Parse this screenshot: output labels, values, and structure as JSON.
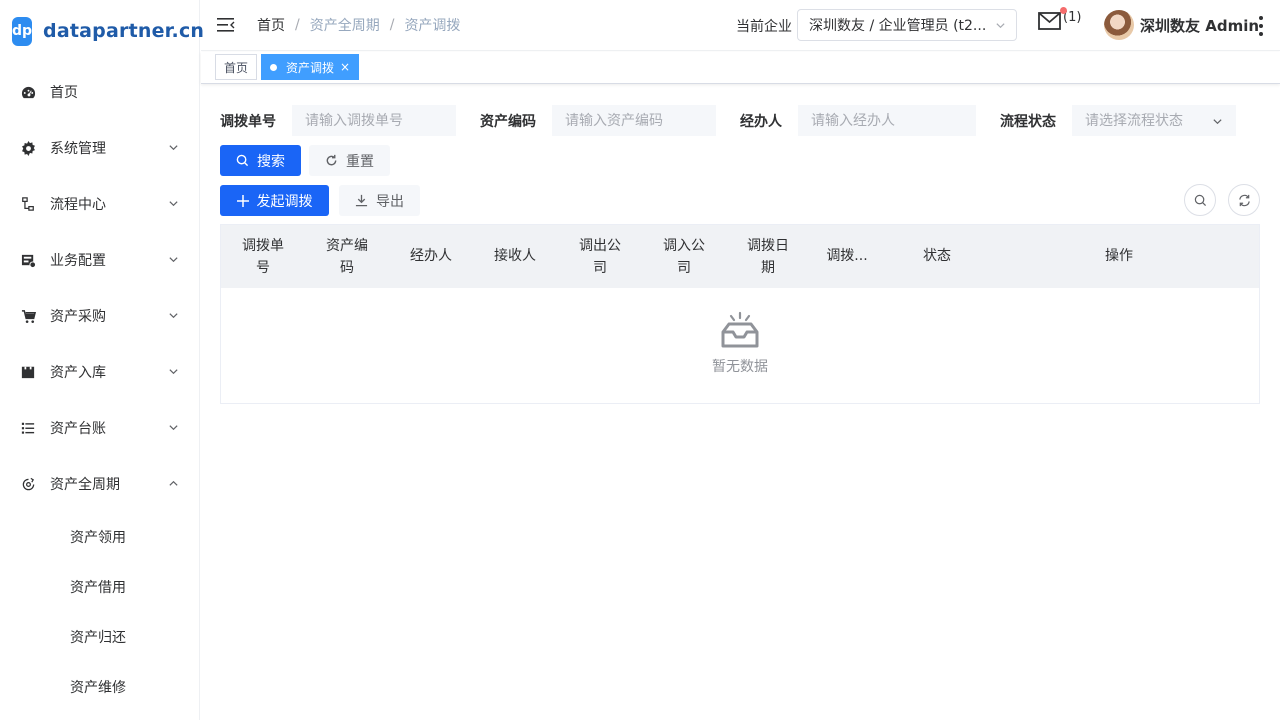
{
  "brand": {
    "mark": "dp",
    "name": "datapartner.cn"
  },
  "sidebar": {
    "items": [
      {
        "label": "首页",
        "icon": "dashboard-icon"
      },
      {
        "label": "系统管理",
        "icon": "gear-icon"
      },
      {
        "label": "流程中心",
        "icon": "flow-icon"
      },
      {
        "label": "业务配置",
        "icon": "config-icon"
      },
      {
        "label": "资产采购",
        "icon": "cart-icon"
      },
      {
        "label": "资产入库",
        "icon": "storage-icon"
      },
      {
        "label": "资产台账",
        "icon": "list-icon"
      },
      {
        "label": "资产全周期",
        "icon": "cycle-icon"
      }
    ],
    "subitems": [
      "资产领用",
      "资产借用",
      "资产归还",
      "资产维修"
    ]
  },
  "header": {
    "breadcrumb": [
      "首页",
      "资产全周期",
      "资产调拨"
    ],
    "separator": "/",
    "company_label": "当前企业",
    "company_value": "深圳数友 / 企业管理员 (t2...",
    "mail_count": "(1)",
    "user_name": "深圳数友 Admin"
  },
  "tags": [
    {
      "label": "首页",
      "active": false
    },
    {
      "label": "资产调拨",
      "active": true,
      "close": "×"
    }
  ],
  "search": {
    "fields": [
      {
        "label": "调拨单号",
        "placeholder": "请输入调拨单号"
      },
      {
        "label": "资产编码",
        "placeholder": "请输入资产编码"
      },
      {
        "label": "经办人",
        "placeholder": "请输入经办人"
      },
      {
        "label": "流程状态",
        "placeholder": "请选择流程状态"
      }
    ],
    "search_button": "搜索",
    "reset_button": "重置"
  },
  "toolbar": {
    "add_button": "发起调拨",
    "export_button": "导出"
  },
  "table": {
    "columns": [
      {
        "line1": "调拨单",
        "line2": "号"
      },
      {
        "line1": "资产编",
        "line2": "码"
      },
      {
        "line1": "经办人",
        "line2": ""
      },
      {
        "line1": "接收人",
        "line2": ""
      },
      {
        "line1": "调出公",
        "line2": "司"
      },
      {
        "line1": "调入公",
        "line2": "司"
      },
      {
        "line1": "调拨日",
        "line2": "期"
      },
      {
        "line1": "调拨...",
        "line2": ""
      },
      {
        "line1": "状态",
        "line2": ""
      },
      {
        "line1": "操作",
        "line2": ""
      }
    ],
    "empty_text": "暂无数据"
  },
  "colors": {
    "primary": "#1a65f6",
    "tag_active": "#409eff",
    "notification_dot": "#f56c6c"
  }
}
